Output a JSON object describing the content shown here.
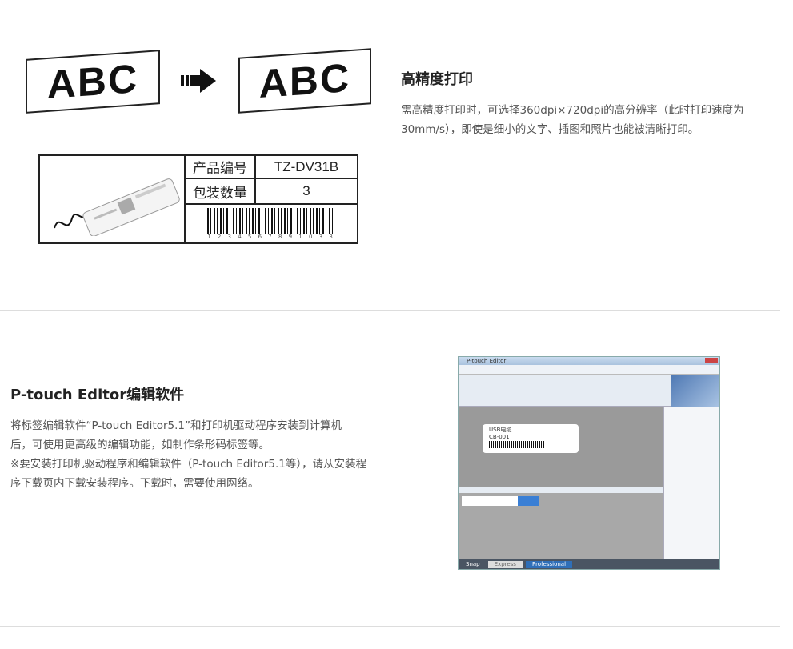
{
  "section1": {
    "title": "高精度打印",
    "paragraph": [
      "需高精度打印时，可选择360dpi×720dpi的高分辨率（此时打印速度为",
      "30mm/s），即使是细小的文字、插图和照片也能被清晰打印。"
    ],
    "illustration": {
      "banner_left": "ABC",
      "banner_right": "ABC",
      "table": {
        "rows": [
          {
            "label": "产品编号",
            "value": "TZ-DV31B"
          },
          {
            "label": "包装数量",
            "value": "3"
          }
        ],
        "barcode_digits": "1 2 3 4 5 6 7 8 9 1 0 3 3"
      }
    }
  },
  "section2": {
    "title": "P-touch Editor编辑软件",
    "paragraph": [
      "将标签编辑软件“P-touch Editor5.1”和打印机驱动程序安装到计算机",
      "后，可使用更高级的编辑功能，如制作条形码标签等。",
      "※要安装打印机驱动程序和编辑软件（P-touch Editor5.1等），请从安装程",
      "序下载页内下载安装程序。下载时，需要使用网络。"
    ],
    "screenshot": {
      "window_title": "P-touch Editor",
      "label_line1": "USB电缆",
      "label_line2": "CB-001",
      "mode_tabs": [
        "Snap",
        "Express",
        "Professional"
      ]
    }
  }
}
